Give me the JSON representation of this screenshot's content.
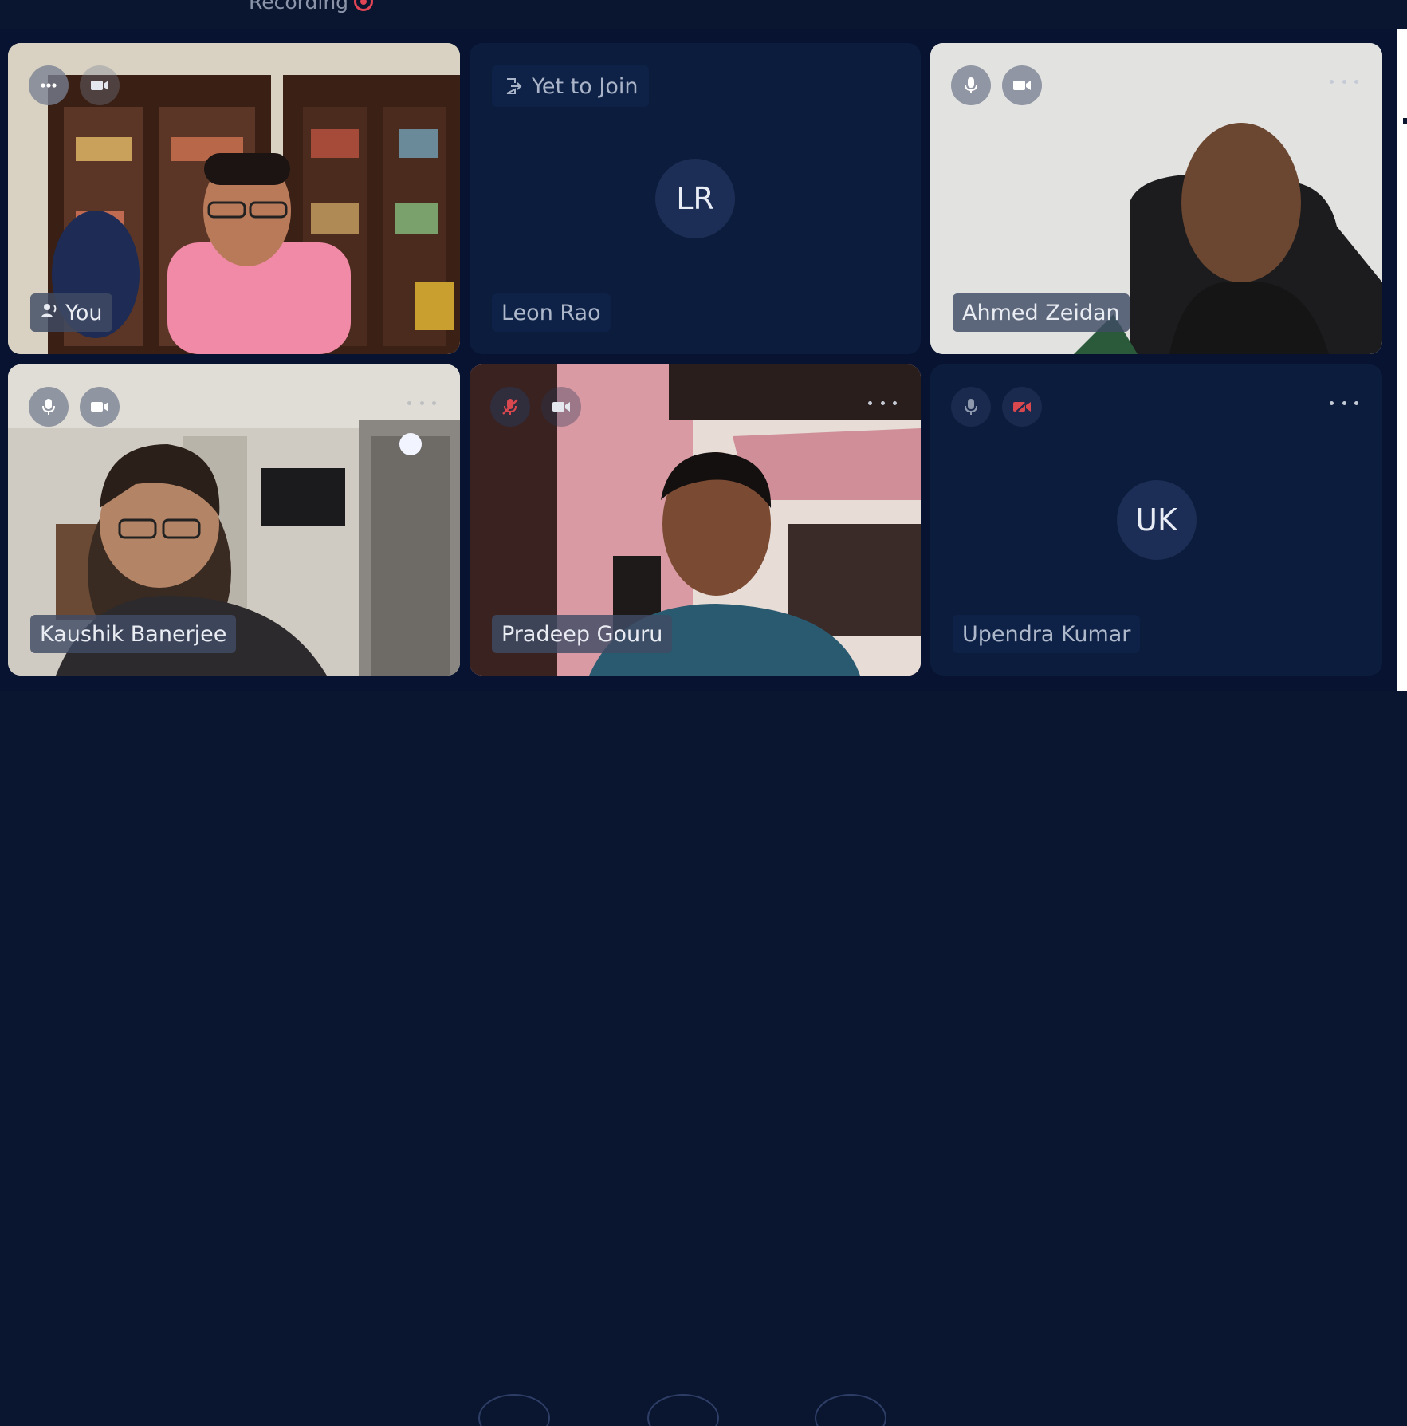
{
  "header": {
    "recording_label": "Recording"
  },
  "tiles": [
    {
      "name": "You",
      "video": true,
      "status_icons": [
        "more-icon",
        "camera-icon"
      ]
    },
    {
      "name": "Leon Rao",
      "initials": "LR",
      "video": false,
      "status_label": "Yet to Join"
    },
    {
      "name": "Ahmed Zeidan",
      "video": true,
      "status_icons": [
        "microphone-icon",
        "camera-icon",
        "more-icon"
      ]
    },
    {
      "name": "Kaushik Banerjee",
      "video": true,
      "status_icons": [
        "microphone-icon",
        "camera-icon",
        "more-icon"
      ]
    },
    {
      "name": "Pradeep Gouru",
      "video": true,
      "status_icons": [
        "microphone-muted-icon",
        "camera-icon",
        "more-icon"
      ]
    },
    {
      "name": "Upendra Kumar",
      "initials": "UK",
      "video": false,
      "status_icons": [
        "microphone-icon",
        "camera-off-icon",
        "more-icon"
      ]
    }
  ],
  "colors": {
    "background": "#071330",
    "tile_dark": "#0b1c3d",
    "muted_red": "#d9484f",
    "recording_red": "#e04455"
  }
}
